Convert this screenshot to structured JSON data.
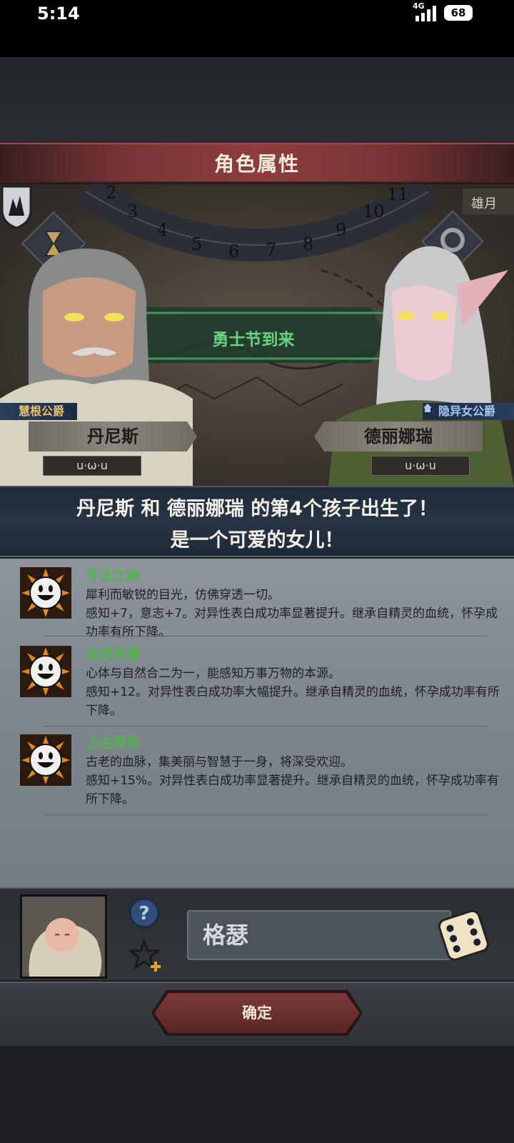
{
  "status": {
    "time": "5:14",
    "network": "4G",
    "battery": "68"
  },
  "title": "角色属性",
  "scene": {
    "event": "勇士节到来",
    "dial_numbers": [
      "2",
      "3",
      "4",
      "5",
      "6",
      "7",
      "8",
      "9",
      "10",
      "11"
    ],
    "corner_label": "雄月",
    "left": {
      "rank": "慧根公爵",
      "name": "丹尼斯",
      "face": "u·ω·u"
    },
    "right": {
      "rank": "隐异女公爵",
      "name": "德丽娜瑞",
      "face": "u·ω·u"
    }
  },
  "announcement": {
    "line1": "丹尼斯 和 德丽娜瑞 的第4个孩子出生了！",
    "line2": "是一个可爱的女儿！"
  },
  "traits": [
    {
      "name": "专注之眸",
      "desc": "犀利而敏锐的目光，仿佛穿透一切。\n感知+7，意志+7。对异性表白成功率显著提升。继承自精灵的血统，怀孕成功率有所下降。",
      "icon": "smiley-sun-icon"
    },
    {
      "name": "自然共感",
      "desc": "心体与自然合二为一，能感知万事万物的本源。\n感知+12。对异性表白成功率大幅提升。继承自精灵的血统，怀孕成功率有所下降。",
      "icon": "smiley-sun-icon"
    },
    {
      "name": "上古灵性",
      "desc": "古老的血脉，集美丽与智慧于一身，将深受欢迎。\n感知+15%。对异性表白成功率显著提升。继承自精灵的血统，怀孕成功率有所下降。",
      "icon": "smiley-sun-icon"
    }
  ],
  "child": {
    "name_value": "格瑟"
  },
  "confirm_label": "确定",
  "colors": {
    "accent_red": "#8d3d3e",
    "trait_green": "#4fb64a",
    "rank_gold": "#e8c26a"
  }
}
